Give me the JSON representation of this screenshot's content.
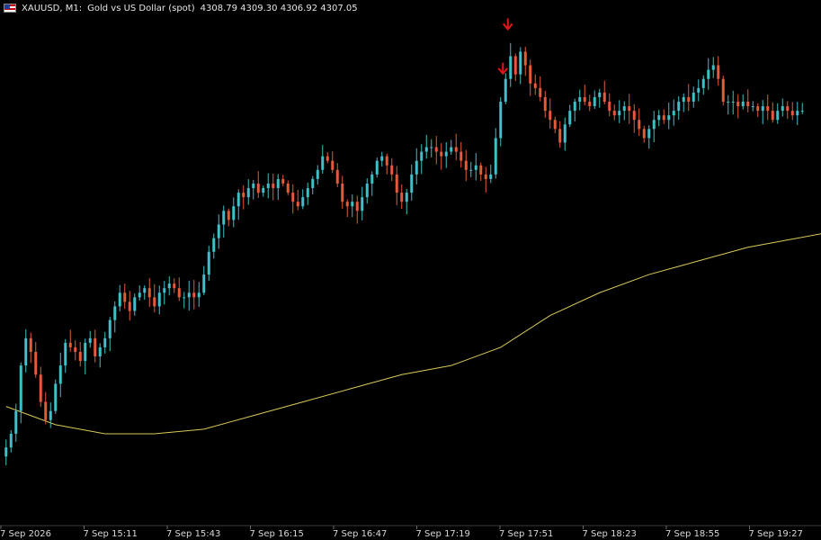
{
  "header": {
    "symbol": "XAUUSD, M1:",
    "description": "Gold vs US Dollar (spot)",
    "ohlc": "4308.79 4309.30 4306.92 4307.05"
  },
  "colors": {
    "background": "#000000",
    "bull": "#3fbfc7",
    "bear": "#e55a3a",
    "ma_line": "#d8c85a",
    "signal_arrow": "#e01818",
    "axis_text": "#d8d8d8"
  },
  "chart_data": {
    "type": "candlestick",
    "timeframe": "M1",
    "x_tick_labels": [
      "7 Sep 2026",
      "7 Sep 15:11",
      "7 Sep 15:43",
      "7 Sep 16:15",
      "7 Sep 16:47",
      "7 Sep 17:19",
      "7 Sep 17:51",
      "7 Sep 18:23",
      "7 Sep 18:55",
      "7 Sep 19:27"
    ],
    "y_range": [
      4206,
      4316
    ],
    "closes": [
      4222,
      4225,
      4230,
      4240,
      4246,
      4243,
      4238,
      4232,
      4228,
      4230,
      4236,
      4240,
      4245,
      4244,
      4243,
      4241,
      4245,
      4246,
      4242,
      4244,
      4246,
      4250,
      4253,
      4256,
      4254,
      4252,
      4255,
      4256,
      4257,
      4255,
      4253,
      4256,
      4257,
      4258,
      4257,
      4255,
      4255,
      4256,
      4255,
      4256,
      4260,
      4265,
      4268,
      4271,
      4274,
      4272,
      4275,
      4278,
      4277,
      4279,
      4280,
      4278,
      4279,
      4280,
      4279,
      4281,
      4280,
      4278,
      4276,
      4275,
      4277,
      4279,
      4281,
      4283,
      4286,
      4285,
      4283,
      4280,
      4276,
      4275,
      4276,
      4274,
      4277,
      4280,
      4282,
      4285,
      4286,
      4284,
      4282,
      4278,
      4276,
      4278,
      4282,
      4285,
      4287,
      4288,
      4288,
      4287,
      4286,
      4287,
      4288,
      4287,
      4285,
      4283,
      4283,
      4284,
      4282,
      4281,
      4282,
      4290,
      4298,
      4303,
      4308,
      4304,
      4309,
      4306,
      4302,
      4301,
      4299,
      4296,
      4294,
      4292,
      4289,
      4293,
      4296,
      4298,
      4299,
      4298,
      4297,
      4299,
      4300,
      4298,
      4296,
      4295,
      4296,
      4297,
      4296,
      4294,
      4292,
      4290,
      4292,
      4294,
      4295,
      4294,
      4295,
      4296,
      4298,
      4299,
      4298,
      4300,
      4301,
      4303,
      4305,
      4306,
      4303,
      4298,
      4298,
      4298,
      4297,
      4298,
      4297,
      4297,
      4296,
      4297,
      4296,
      4294,
      4296,
      4297,
      4296,
      4295,
      4296,
      4296
    ],
    "moving_average": {
      "points": [
        [
          0,
          4231
        ],
        [
          10,
          4227
        ],
        [
          20,
          4225
        ],
        [
          30,
          4225
        ],
        [
          40,
          4226
        ],
        [
          50,
          4229
        ],
        [
          60,
          4232
        ],
        [
          70,
          4235
        ],
        [
          80,
          4238
        ],
        [
          90,
          4240
        ],
        [
          100,
          4244
        ],
        [
          110,
          4251
        ],
        [
          120,
          4256
        ],
        [
          130,
          4260
        ],
        [
          140,
          4263
        ],
        [
          150,
          4266
        ],
        [
          160,
          4268
        ],
        [
          165,
          4269
        ]
      ]
    },
    "sell_signals": [
      {
        "index": 101,
        "type": "sell"
      },
      {
        "index": 102,
        "type": "sell"
      }
    ]
  }
}
